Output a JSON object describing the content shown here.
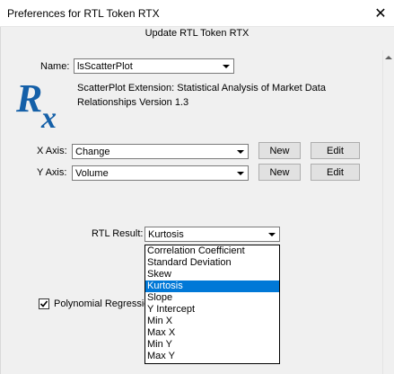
{
  "window": {
    "title": "Preferences for RTL Token RTX",
    "close_glyph": "✕"
  },
  "heading": "Update RTL Token RTX",
  "name_field": {
    "label": "Name:",
    "value": "lsScatterPlot"
  },
  "logo": {
    "text": "Rx",
    "color": "#1560a8"
  },
  "description": [
    "ScatterPlot Extension: Statistical Analysis of Market Data",
    "Relationships Version 1.3"
  ],
  "x_axis": {
    "label": "X Axis:",
    "value": "Change",
    "new_label": "New",
    "edit_label": "Edit"
  },
  "y_axis": {
    "label": "Y Axis:",
    "value": "Volume",
    "new_label": "New",
    "edit_label": "Edit"
  },
  "rtl_result": {
    "label": "RTL Result:",
    "value": "Kurtosis",
    "options": [
      "Correlation Coefficient",
      "Standard Deviation",
      "Skew",
      "Kurtosis",
      "Slope",
      "Y Intercept",
      "Min X",
      "Max X",
      "Min Y",
      "Max Y"
    ],
    "selected_index": 3
  },
  "polynomial_regression": {
    "label": "Polynomial Regressio",
    "checked": true
  },
  "colors": {
    "selection": "#0078d7",
    "dialog_bg": "#f0f0f0"
  }
}
